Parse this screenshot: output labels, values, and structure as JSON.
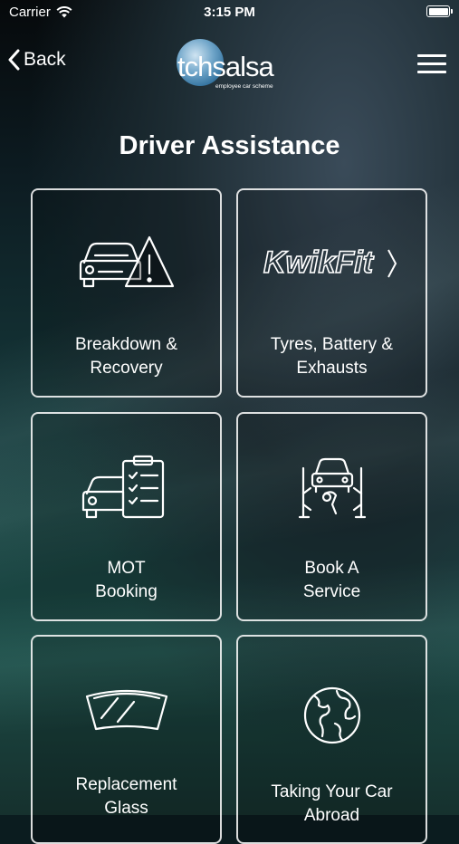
{
  "status_bar": {
    "carrier": "Carrier",
    "time": "3:15 PM"
  },
  "nav": {
    "back_label": "Back",
    "logo_text": "tchsalsa",
    "logo_tagline": "employee car scheme"
  },
  "page": {
    "title": "Driver Assistance"
  },
  "tiles": [
    {
      "label": "Breakdown &\nRecovery",
      "icon": "car-warning-icon"
    },
    {
      "label": "Tyres, Battery &\nExhausts",
      "icon": "kwik-fit-logo",
      "logo_text": "KwikFit"
    },
    {
      "label": "MOT\nBooking",
      "icon": "car-checklist-icon"
    },
    {
      "label": "Book A\nService",
      "icon": "car-lift-icon"
    },
    {
      "label": "Replacement\nGlass",
      "icon": "windscreen-icon"
    },
    {
      "label": "Taking Your Car\nAbroad",
      "icon": "globe-icon"
    }
  ]
}
